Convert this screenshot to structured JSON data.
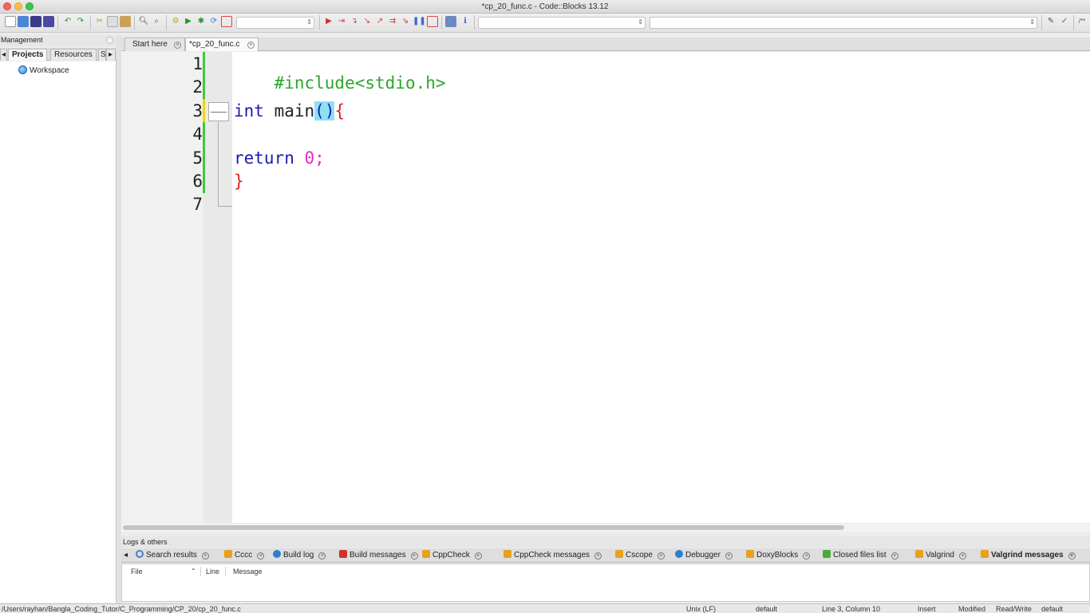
{
  "window": {
    "title": "*cp_20_func.c - Code::Blocks 13.12"
  },
  "management": {
    "title": "Management",
    "tabs": [
      {
        "label": "Projects",
        "active": true
      },
      {
        "label": "Resources",
        "active": false
      },
      {
        "label": "S",
        "active": false
      }
    ],
    "tree": {
      "workspace_label": "Workspace"
    }
  },
  "editor": {
    "tabs": [
      {
        "label": "Start here",
        "active": false
      },
      {
        "label": "*cp_20_func.c",
        "active": true
      }
    ],
    "line_numbers": [
      "1",
      "2",
      "3",
      "4",
      "5",
      "6",
      "7"
    ],
    "code": {
      "line1": "#include<stdio.h>",
      "line3_kw": "int",
      "line3_id": "main",
      "line3_paren": "()",
      "line3_brace": "{",
      "line5_kw": "return",
      "line5_num": "0",
      "line5_semi": ";",
      "line6_brace": "}"
    }
  },
  "logs": {
    "title": "Logs & others",
    "tabs": [
      {
        "label": "Search results",
        "icon": "search-icon",
        "color": "#4a7fc4"
      },
      {
        "label": "Cccc",
        "icon": "cccc-icon",
        "color": "#e6a21d"
      },
      {
        "label": "Build log",
        "icon": "build-log-icon",
        "color": "#2a80d0"
      },
      {
        "label": "Build messages",
        "icon": "build-messages-icon",
        "color": "#d23030"
      },
      {
        "label": "CppCheck",
        "icon": "cppcheck-icon",
        "color": "#e6a21d"
      },
      {
        "label": "CppCheck messages",
        "icon": "cppcheck-messages-icon",
        "color": "#e6a21d"
      },
      {
        "label": "Cscope",
        "icon": "cscope-icon",
        "color": "#e6a21d"
      },
      {
        "label": "Debugger",
        "icon": "debugger-icon",
        "color": "#2a80d0"
      },
      {
        "label": "DoxyBlocks",
        "icon": "doxyblocks-icon",
        "color": "#e6a21d"
      },
      {
        "label": "Closed files list",
        "icon": "closed-files-icon",
        "color": "#4caa3c"
      },
      {
        "label": "Valgrind",
        "icon": "valgrind-icon",
        "color": "#e6a21d"
      },
      {
        "label": "Valgrind messages",
        "icon": "valgrind-messages-icon",
        "color": "#e6a21d",
        "active": true
      }
    ],
    "columns": {
      "file": "File",
      "line": "Line",
      "message": "Message"
    }
  },
  "status": {
    "path": "/Users/rayhan/Bangla_Coding_Tutor/C_Programming/CP_20/cp_20_func.c",
    "line_endings": "Unix (LF)",
    "encoding": "default",
    "position": "Line 3, Column 10",
    "mode": "Insert",
    "modified": "Modified",
    "access": "Read/Write",
    "lang": "default"
  },
  "colors": {
    "preprocessor": "#2ea52e",
    "keyword": "#1c1cad",
    "number": "#e82ad1",
    "brace": "#e02020",
    "changed_margin": "#3ec93e",
    "current_margin": "#f2d400"
  }
}
